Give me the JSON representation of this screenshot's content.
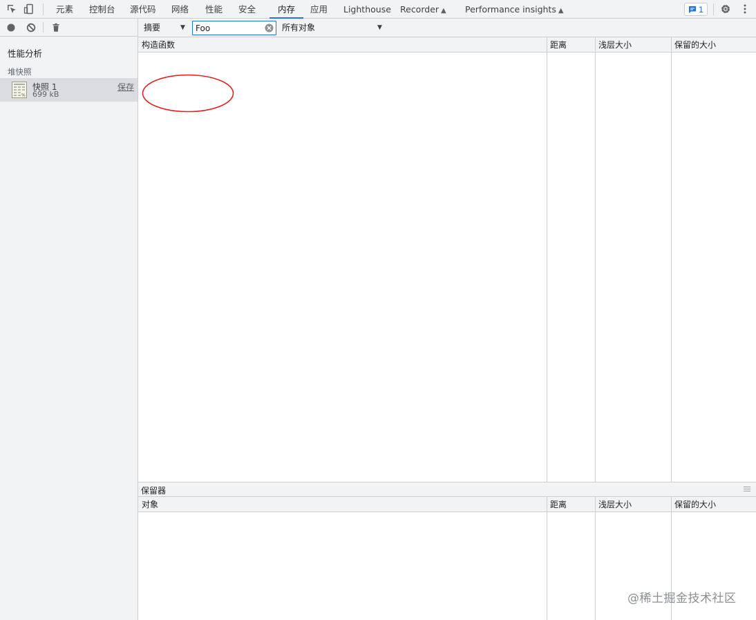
{
  "topbar": {
    "tabs": [
      {
        "label": "元素"
      },
      {
        "label": "控制台"
      },
      {
        "label": "源代码"
      },
      {
        "label": "网络"
      },
      {
        "label": "性能"
      },
      {
        "label": "安全"
      },
      {
        "label": "内存",
        "active": true
      },
      {
        "label": "应用"
      },
      {
        "label": "Lighthouse"
      },
      {
        "label": "Recorder",
        "experimental": true
      },
      {
        "label": "Performance insights",
        "experimental": true
      }
    ],
    "issues_count": "1",
    "icons": [
      "inspect-element-icon",
      "device-toolbar-icon",
      "flask-icon",
      "issues-icon",
      "gear-icon",
      "more-vertical-icon"
    ],
    "accent_color": "#1a73e8"
  },
  "sidebar": {
    "toolbar_icons": [
      "record-icon",
      "clear-icon",
      "trash-icon"
    ],
    "heading": "性能分析",
    "section": "堆快照",
    "snapshot": {
      "title": "快照 1",
      "size": "699 kB",
      "save_label": "保存"
    }
  },
  "filterbar": {
    "view_select": "摘要",
    "class_filter_value": "Foo",
    "objects_select": "所有对象"
  },
  "constructors_table": {
    "columns": [
      "构造函数",
      "距离",
      "浅层大小",
      "保留的大小"
    ],
    "rows": []
  },
  "retainers": {
    "title": "保留器",
    "columns": [
      "对象",
      "距离",
      "浅层大小",
      "保留的大小"
    ],
    "rows": []
  },
  "annotation": {
    "shape": "ellipse",
    "color": "#e02020"
  },
  "watermark": "@稀土掘金技术社区"
}
